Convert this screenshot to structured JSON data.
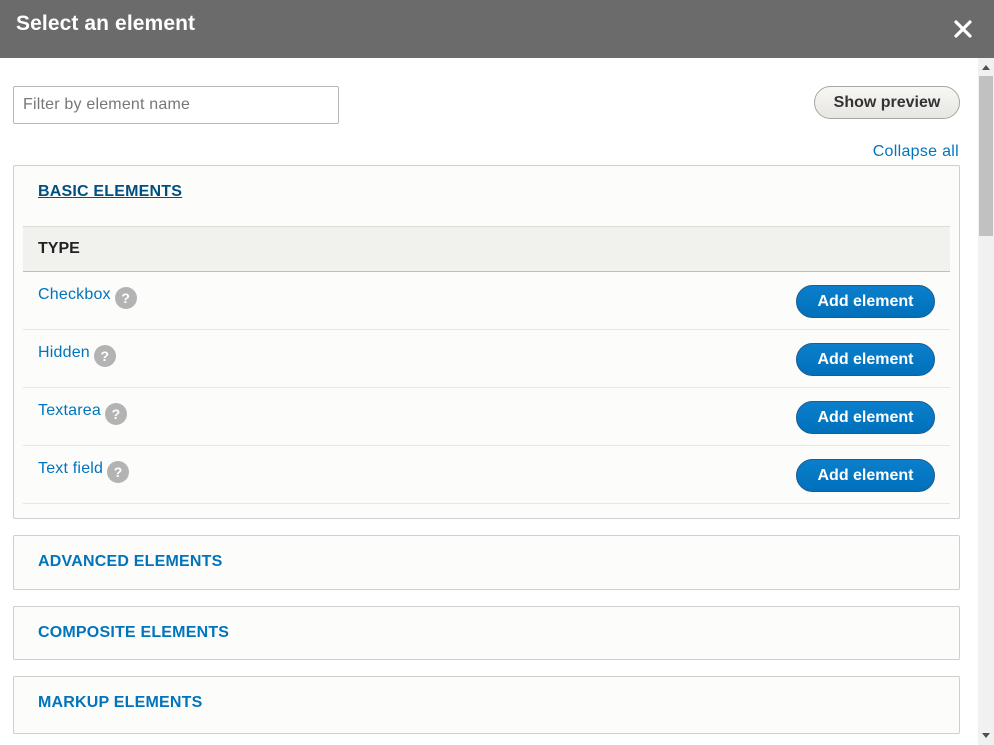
{
  "dialog": {
    "title": "Select an element",
    "close_icon": "close-icon"
  },
  "toolbar": {
    "filter_placeholder": "Filter by element name",
    "filter_value": "",
    "show_preview_label": "Show preview",
    "collapse_all_label": "Collapse all"
  },
  "groups": [
    {
      "label": "BASIC ELEMENTS",
      "expanded": true,
      "column_header": "TYPE",
      "items": [
        {
          "name": "Checkbox",
          "help": "?",
          "action": "Add element"
        },
        {
          "name": "Hidden",
          "help": "?",
          "action": "Add element"
        },
        {
          "name": "Textarea",
          "help": "?",
          "action": "Add element"
        },
        {
          "name": "Text field",
          "help": "?",
          "action": "Add element"
        }
      ]
    },
    {
      "label": "ADVANCED ELEMENTS",
      "expanded": false
    },
    {
      "label": "COMPOSITE ELEMENTS",
      "expanded": false
    },
    {
      "label": "MARKUP ELEMENTS",
      "expanded": false
    }
  ],
  "colors": {
    "title_bar": "#6b6b6b",
    "link": "#0074bd",
    "primary_button": "#0074bd",
    "help_badge": "#b3b3b3"
  }
}
